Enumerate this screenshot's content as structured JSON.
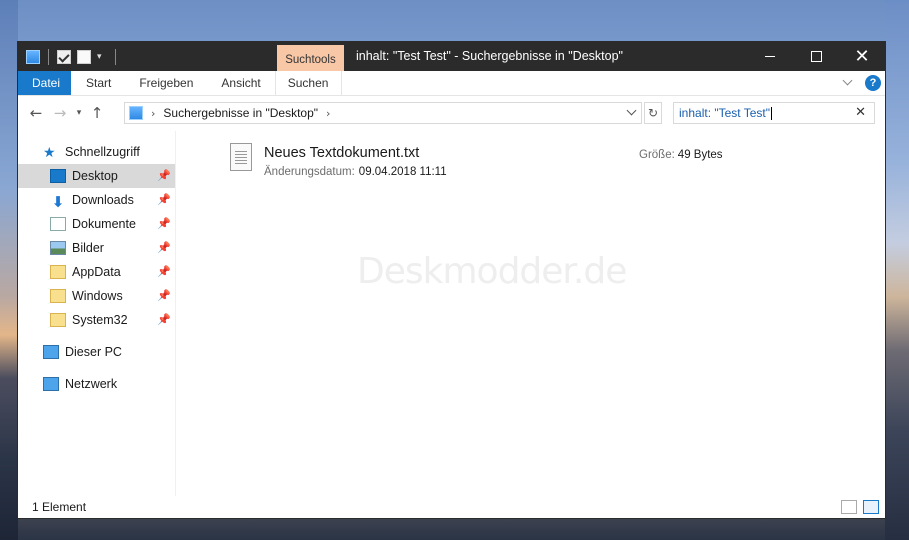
{
  "window": {
    "title": "inhalt: \"Test Test\" - Suchergebnisse in \"Desktop\"",
    "contextual_tab": "Suchtools"
  },
  "ribbon": {
    "tabs": [
      "Datei",
      "Start",
      "Freigeben",
      "Ansicht",
      "Suchen"
    ],
    "help": "?"
  },
  "nav": {
    "address": "Suchergebnisse in \"Desktop\"",
    "search_value": "inhalt: \"Test Test\""
  },
  "sidebar": {
    "quick_access": "Schnellzugriff",
    "items": [
      {
        "label": "Desktop",
        "icon": "desktop-icon"
      },
      {
        "label": "Downloads",
        "icon": "download-icon"
      },
      {
        "label": "Dokumente",
        "icon": "document-icon"
      },
      {
        "label": "Bilder",
        "icon": "picture-icon"
      },
      {
        "label": "AppData",
        "icon": "folder-icon"
      },
      {
        "label": "Windows",
        "icon": "folder-icon"
      },
      {
        "label": "System32",
        "icon": "folder-icon"
      }
    ],
    "this_pc": "Dieser PC",
    "network": "Netzwerk"
  },
  "results": {
    "file_name": "Neues Textdokument.txt",
    "date_label": "Änderungsdatum:",
    "date_value": "09.04.2018 11:11",
    "size_label": "Größe:",
    "size_value": "49 Bytes"
  },
  "watermark": "Deskmodder.de",
  "status": {
    "count": "1 Element"
  },
  "colors": {
    "accent": "#1979ca",
    "titlebar": "#2b2b2b",
    "contextual_tab": "#f8c7a6"
  }
}
